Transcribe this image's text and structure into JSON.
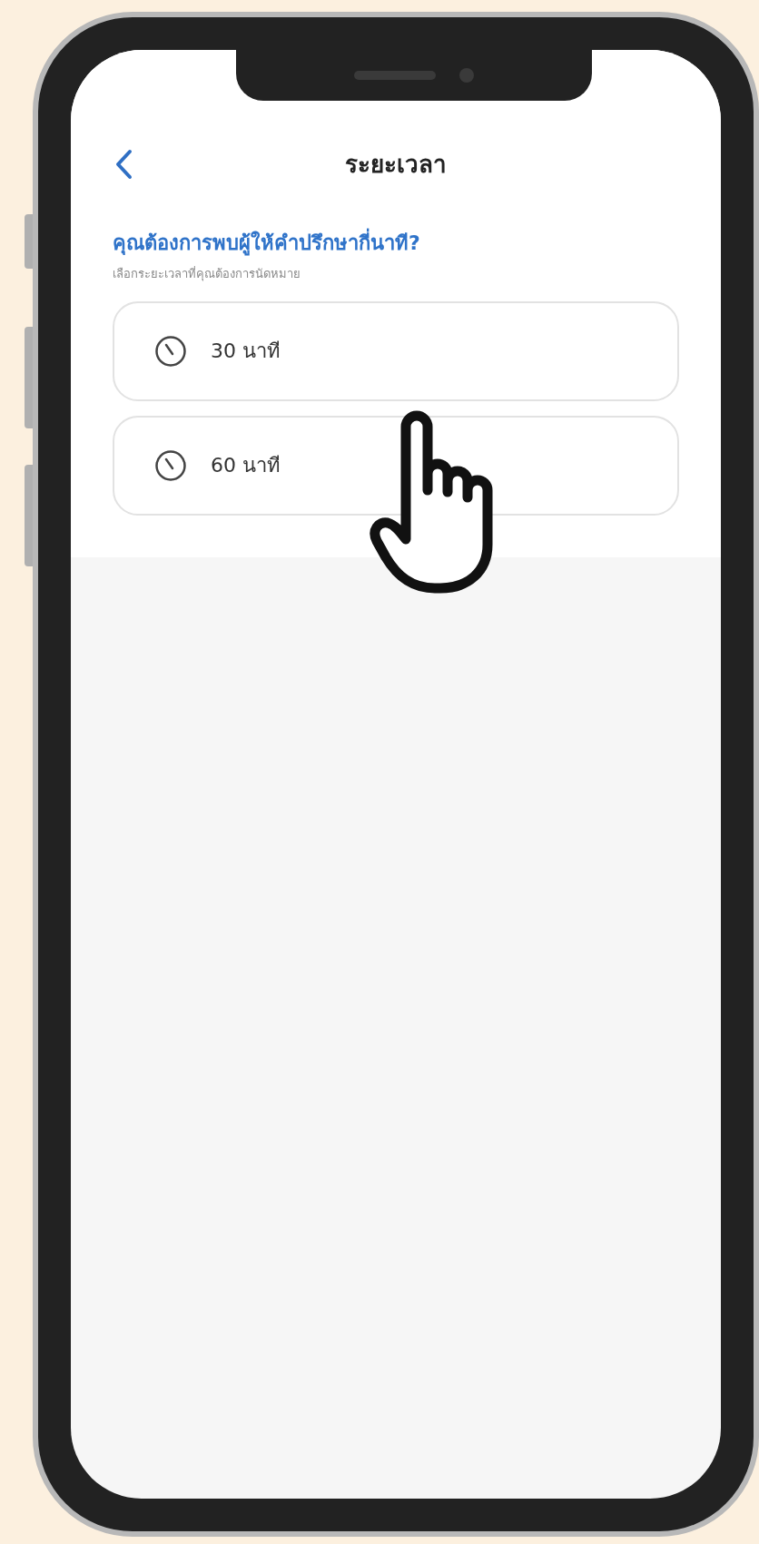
{
  "header": {
    "title": "ระยะเวลา"
  },
  "question": "คุณต้องการพบผู้ให้คำปรึกษากี่นาที?",
  "subtitle": "เลือกระยะเวลาที่คุณต้องการนัดหมาย",
  "options": [
    {
      "label": "30 นาที"
    },
    {
      "label": "60 นาที"
    }
  ]
}
